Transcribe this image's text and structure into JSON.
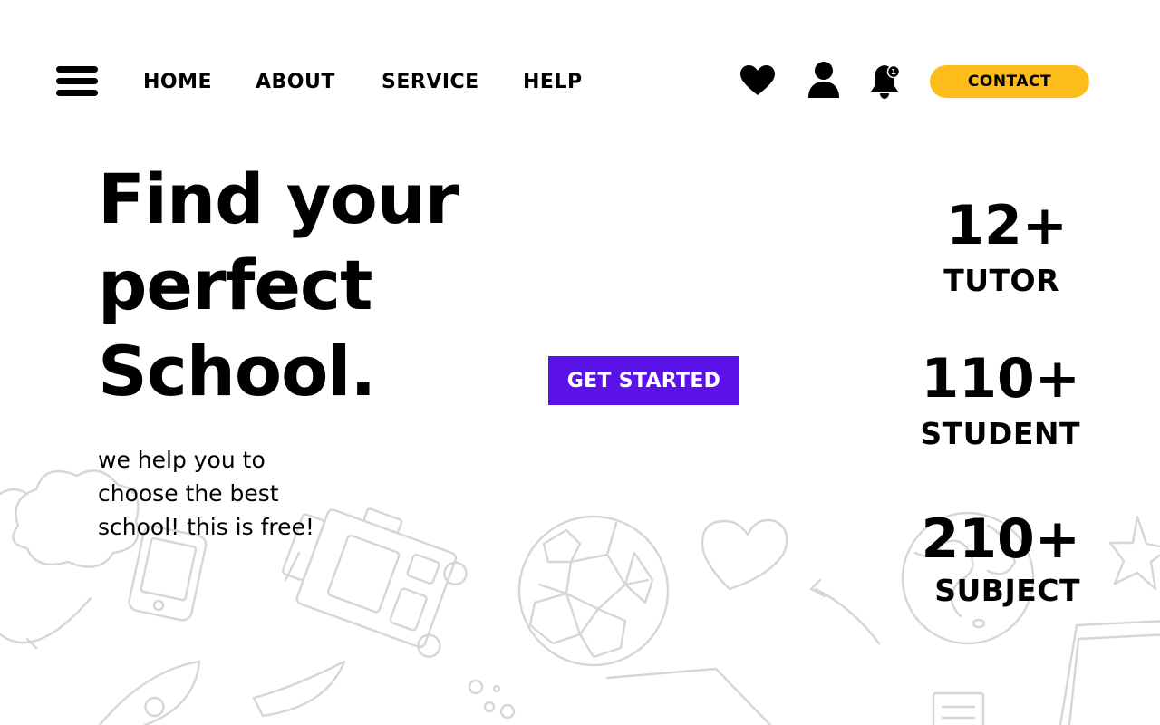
{
  "nav": {
    "links": [
      "HOME",
      "ABOUT",
      "SERVICE",
      "HELP"
    ],
    "notification_count": "1",
    "contact_label": "CONTACT",
    "icons": [
      "menu-icon",
      "heart-icon",
      "user-icon",
      "bell-icon"
    ]
  },
  "hero": {
    "title": "Find your perfect School.",
    "subtitle": "we help you to choose the best school! this is free!",
    "cta_label": "GET STARTED"
  },
  "stats": [
    {
      "value": "12+",
      "label": "TUTOR"
    },
    {
      "value": "110+",
      "label": "STUDENT"
    },
    {
      "value": "210+",
      "label": "SUBJECT"
    }
  ],
  "colors": {
    "accent_yellow": "#fcbc1a",
    "accent_purple": "#5b12e8",
    "text": "#000000",
    "doodle": "#d6d6d6"
  }
}
